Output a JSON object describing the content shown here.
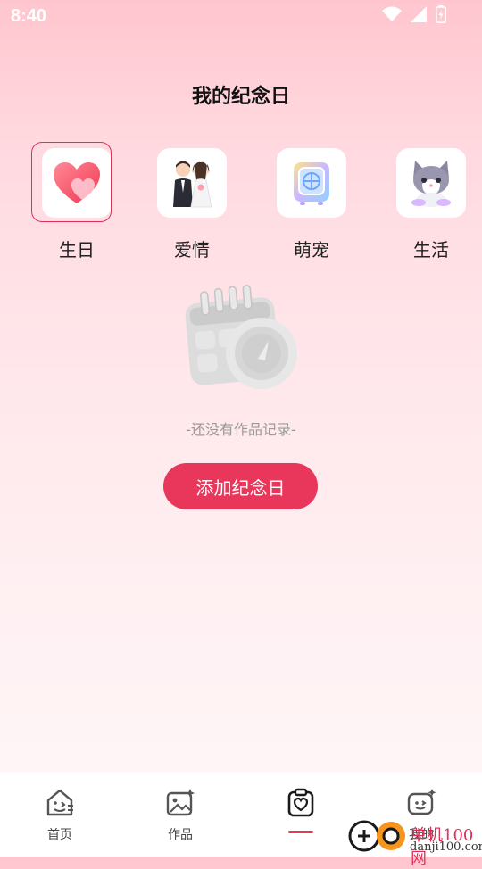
{
  "status": {
    "time": "8:40"
  },
  "page": {
    "title": "我的纪念日"
  },
  "categories": [
    {
      "label": "生日",
      "icon": "heart-icon",
      "selected": true
    },
    {
      "label": "爱情",
      "icon": "wedding-couple-icon",
      "selected": false
    },
    {
      "label": "萌宠",
      "icon": "pet-carrier-icon",
      "selected": false
    },
    {
      "label": "生活",
      "icon": "cat-icon",
      "selected": false
    }
  ],
  "empty": {
    "text": "-还没有作品记录-",
    "icon": "calendar-empty-icon"
  },
  "add_button": {
    "label": "添加纪念日"
  },
  "tabs": [
    {
      "label": "首页",
      "icon": "home-face-icon"
    },
    {
      "label": "作品",
      "icon": "gallery-icon"
    },
    {
      "label": "",
      "icon": "anniversary-icon",
      "active": true
    },
    {
      "label": "我的",
      "icon": "profile-face-icon"
    }
  ],
  "watermark": {
    "text": "单机100网",
    "sub": "danji100.com"
  },
  "colors": {
    "accent": "#e9365b",
    "selected_border": "#e0305a",
    "muted_text": "#9a9a9a"
  }
}
